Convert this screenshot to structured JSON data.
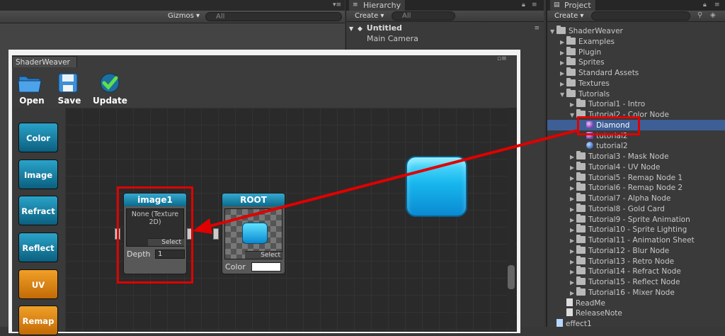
{
  "scene": {
    "gizmos_label": "Gizmos",
    "search_placeholder": "All"
  },
  "hierarchy": {
    "tab_title": "Hierarchy",
    "create_label": "Create",
    "search_placeholder": "All",
    "scene_name": "Untitled",
    "items": [
      "Main Camera"
    ]
  },
  "project": {
    "tab_title": "Project",
    "create_label": "Create",
    "tree": [
      {
        "label": "ShaderWeaver",
        "type": "folder",
        "open": true
      },
      {
        "label": "Examples",
        "type": "folder"
      },
      {
        "label": "Plugin",
        "type": "folder"
      },
      {
        "label": "Sprites",
        "type": "folder"
      },
      {
        "label": "Standard Assets",
        "type": "folder"
      },
      {
        "label": "Textures",
        "type": "folder"
      },
      {
        "label": "Tutorials",
        "type": "folder",
        "open": true
      },
      {
        "label": "Tutorial1 - Intro",
        "type": "folder"
      },
      {
        "label": "Tutorial2 - Color Node",
        "type": "folder",
        "open": true
      },
      {
        "label": "Diamond",
        "type": "shader",
        "selected": true
      },
      {
        "label": "tutorial2",
        "type": "shader"
      },
      {
        "label": "tutorial2",
        "type": "material"
      },
      {
        "label": "Tutorial3 - Mask Node",
        "type": "folder"
      },
      {
        "label": "Tutorial4 - UV Node",
        "type": "folder"
      },
      {
        "label": "Tutorial5 - Remap Node 1",
        "type": "folder"
      },
      {
        "label": "Tutorial6 - Remap Node 2",
        "type": "folder"
      },
      {
        "label": "Tutorial7 - Alpha Node",
        "type": "folder"
      },
      {
        "label": "Tutorial8 - Gold Card",
        "type": "folder"
      },
      {
        "label": "Tutorial9 - Sprite Animation",
        "type": "folder"
      },
      {
        "label": "Tutorial10 - Sprite Lighting",
        "type": "folder"
      },
      {
        "label": "Tutorial11 - Animation Sheet",
        "type": "folder"
      },
      {
        "label": "Tutorial12 - Blur Node",
        "type": "folder"
      },
      {
        "label": "Tutorial13 - Retro Node",
        "type": "folder"
      },
      {
        "label": "Tutorial14 - Refract Node",
        "type": "folder"
      },
      {
        "label": "Tutorial15 - Reflect Node",
        "type": "folder"
      },
      {
        "label": "Tutorial16 - Mixer Node",
        "type": "folder"
      },
      {
        "label": "ReadMe",
        "type": "file"
      },
      {
        "label": "ReleaseNote",
        "type": "file"
      },
      {
        "label": "effect1",
        "type": "script"
      }
    ]
  },
  "shaderweaver": {
    "window_title": "ShaderWeaver",
    "toolbar": {
      "open": "Open",
      "save": "Save",
      "update": "Update"
    },
    "palette": [
      {
        "label": "Color",
        "color": "blue"
      },
      {
        "label": "Image",
        "color": "blue"
      },
      {
        "label": "Refract",
        "color": "blue"
      },
      {
        "label": "Reflect",
        "color": "blue"
      },
      {
        "label": "UV",
        "color": "orange"
      },
      {
        "label": "Remap",
        "color": "orange"
      }
    ],
    "image_node": {
      "title": "image1",
      "texture_text": "None (Texture 2D)",
      "select_label": "Select",
      "depth_label": "Depth",
      "depth_value": "1"
    },
    "root_node": {
      "title": "ROOT",
      "select_label": "Select",
      "color_label": "Color",
      "color_value": "#ffffff"
    }
  },
  "colors": {
    "highlight": "#e00000",
    "selection": "#3e5f96",
    "node_accent": "#0b8ab8"
  }
}
